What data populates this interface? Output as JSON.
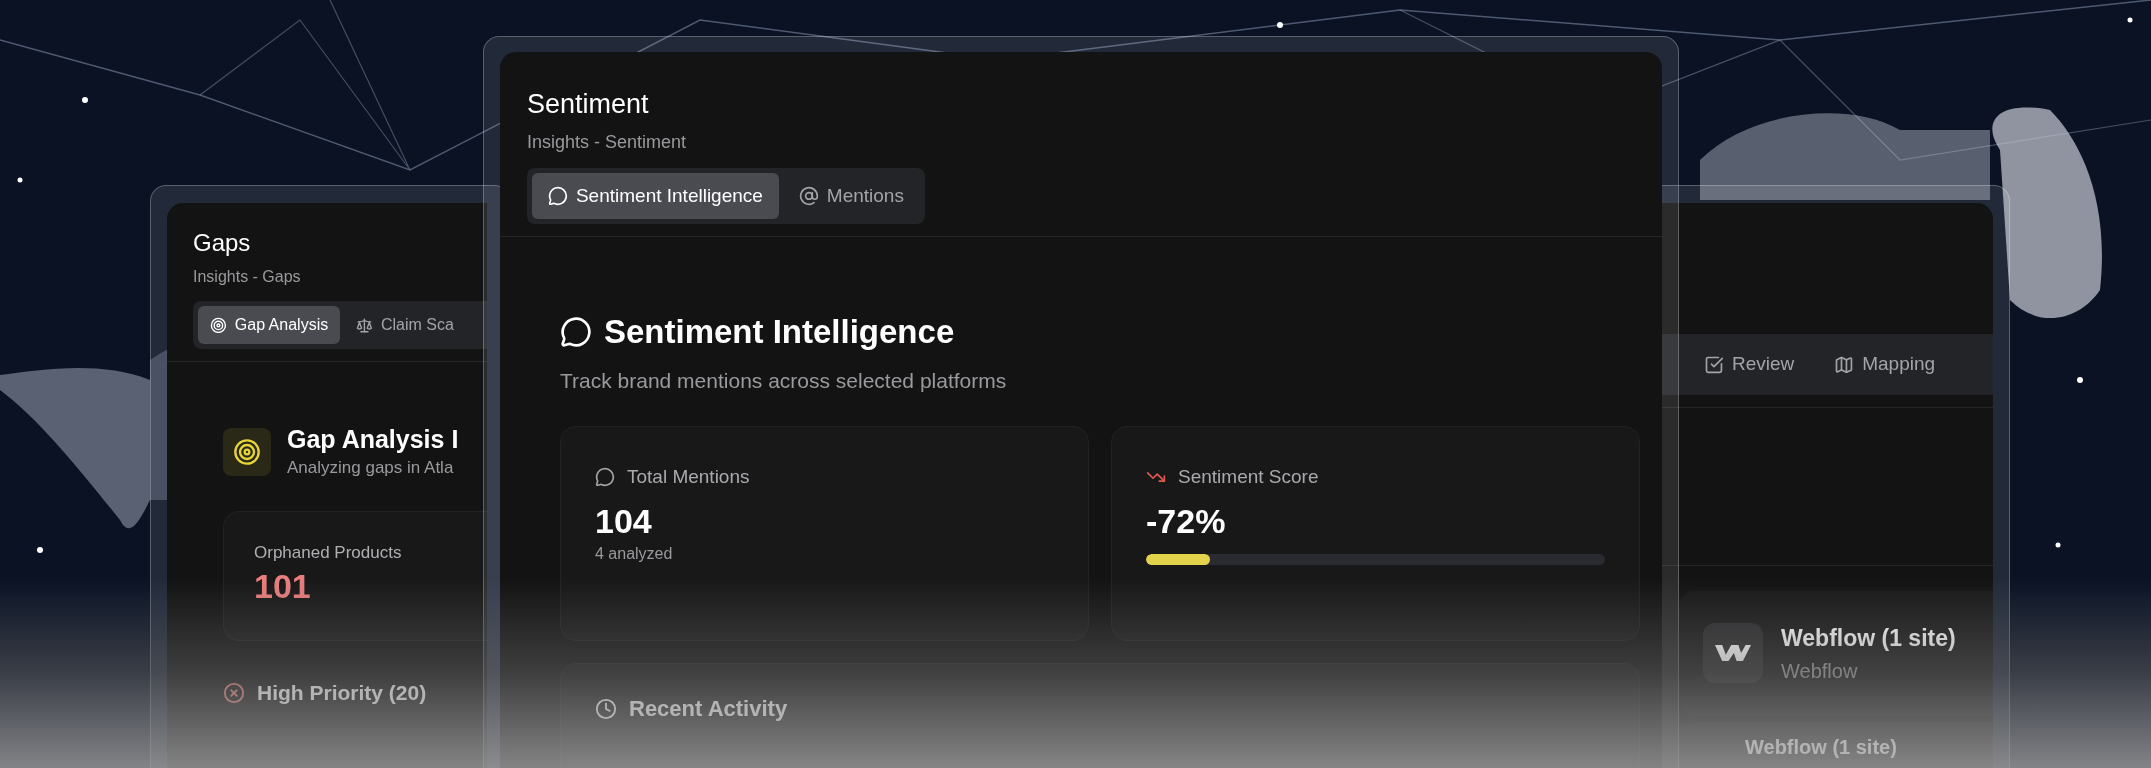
{
  "gaps_window": {
    "title": "Gaps",
    "breadcrumb": "Insights - Gaps",
    "tabs": [
      {
        "label": "Gap Analysis",
        "selected": true
      },
      {
        "label": "Claim Sca",
        "selected": false
      }
    ],
    "heading": "Gap Analysis I",
    "subheading": "Analyzing gaps in Atla",
    "stat": {
      "label": "Orphaned Products",
      "value": "101"
    },
    "section": "High Priority (20)"
  },
  "sentiment_window": {
    "title": "Sentiment",
    "breadcrumb": "Insights - Sentiment",
    "tabs": [
      {
        "label": "Sentiment Intelligence",
        "selected": true
      },
      {
        "label": "Mentions",
        "selected": false
      }
    ],
    "heading": "Sentiment Intelligence",
    "description": "Track brand mentions across selected platforms",
    "stats": [
      {
        "kind": "count",
        "label": "Total Mentions",
        "value": "104",
        "note": "4 analyzed"
      },
      {
        "kind": "meter",
        "label": "Sentiment Score",
        "value": "-72%",
        "level": 0.14
      }
    ],
    "section": "Recent Activity"
  },
  "platforms_window": {
    "tabs": [
      {
        "label": "Review",
        "selected": false
      },
      {
        "label": "Mapping",
        "selected": false
      }
    ],
    "integration": {
      "name": "Webflow (1 site)",
      "platform": "Webflow"
    },
    "next_item": "Webflow (1 site)"
  }
}
